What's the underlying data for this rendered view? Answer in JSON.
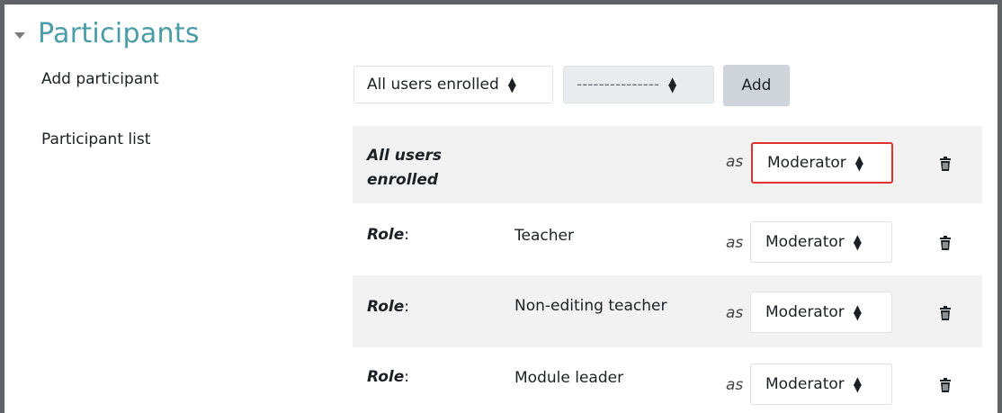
{
  "section": {
    "title": "Participants"
  },
  "add_participant": {
    "label": "Add participant",
    "user_select_value": "All users enrolled",
    "role_select_value": "---------------",
    "add_button": "Add"
  },
  "participant_list": {
    "label": "Participant list",
    "rows": [
      {
        "who_line1": "All users",
        "who_line2": "enrolled",
        "as": "as",
        "role_value": "Moderator",
        "highlighted": true
      },
      {
        "who": "Role",
        "colon": ":",
        "role_name": "Teacher",
        "as": "as",
        "role_value": "Moderator"
      },
      {
        "who": "Role",
        "colon": ":",
        "role_name": "Non-editing teacher",
        "as": "as",
        "role_value": "Moderator"
      },
      {
        "who": "Role",
        "colon": ":",
        "role_name": "Module leader",
        "as": "as",
        "role_value": "Moderator"
      }
    ]
  },
  "icons": {
    "collapse": "caret-down-icon",
    "delete": "trash-icon",
    "select": "sort-arrows-icon"
  },
  "colors": {
    "accent": "#4a9ca6",
    "highlight_border": "#e0332f",
    "row_shade": "#f2f2f2"
  }
}
